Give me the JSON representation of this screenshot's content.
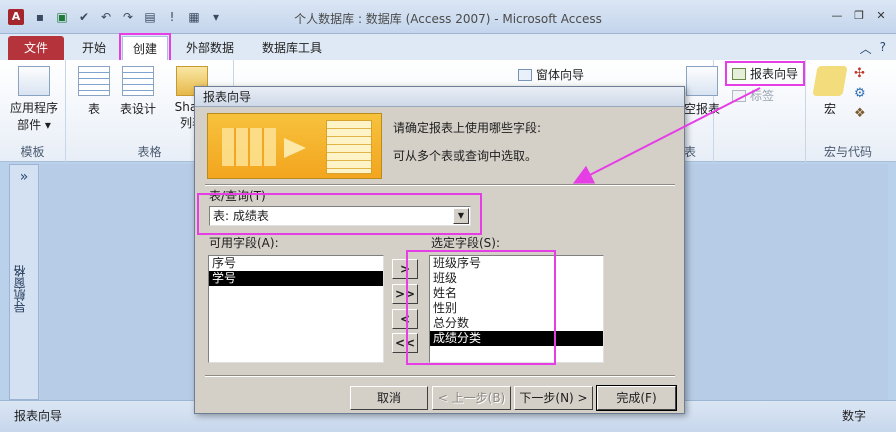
{
  "window": {
    "title": "个人数据库 : 数据库 (Access 2007)  -  Microsoft Access",
    "app_icon": "A",
    "qat_icons": [
      "save-icon",
      "excel-icon",
      "check-icon",
      "undo-icon",
      "redo-icon",
      "form-icon",
      "exclamation-icon",
      "table-icon",
      "dropdown-icon"
    ],
    "controls": [
      "minimize",
      "restore",
      "close"
    ]
  },
  "ribbon": {
    "tabs": [
      {
        "id": "file",
        "label": "文件"
      },
      {
        "id": "home",
        "label": "开始"
      },
      {
        "id": "create",
        "label": "创建"
      },
      {
        "id": "external",
        "label": "外部数据"
      },
      {
        "id": "dbtools",
        "label": "数据库工具"
      }
    ],
    "groups": {
      "templates": {
        "label": "模板",
        "app_parts_label": "应用程序\n部件 ▾"
      },
      "tables": {
        "label": "表格",
        "table_label": "表",
        "design_label": "表设计",
        "share_label": "Share",
        "list_label": "列表"
      },
      "reports": {
        "label": "报表",
        "report_wizard_label": "报表向导",
        "labels_label": "标签",
        "blank_report_label": "空报表"
      },
      "forms": {
        "form_wizard_label": "窗体向导"
      },
      "macros": {
        "label": "宏与代码",
        "macro_label": "宏"
      }
    }
  },
  "nav_pane": {
    "label": "导航窗格",
    "chevron": "»"
  },
  "status_bar": {
    "left": "报表向导",
    "right": "数字"
  },
  "dialog": {
    "title": "报表向导",
    "prompt_line1": "请确定报表上使用哪些字段:",
    "prompt_line2": "可从多个表或查询中选取。",
    "table_query_label": "表/查询(T)",
    "table_query_value": "表: 成绩表",
    "available_label": "可用字段(A):",
    "selected_label": "选定字段(S):",
    "available_fields": [
      "序号",
      "学号"
    ],
    "available_selected_index": 1,
    "selected_fields": [
      "班级序号",
      "班级",
      "姓名",
      "性别",
      "总分数",
      "成绩分类"
    ],
    "selected_selected_index": 5,
    "move_buttons": [
      ">",
      ">>",
      "<",
      "<<"
    ],
    "buttons": {
      "cancel": "取消",
      "back": "< 上一步(B)",
      "next": "下一步(N) >",
      "finish": "完成(F)"
    }
  },
  "colors": {
    "highlight": "#e53ee5",
    "file_tab": "#b5343c",
    "dialog_bg": "#d4d0c8"
  }
}
